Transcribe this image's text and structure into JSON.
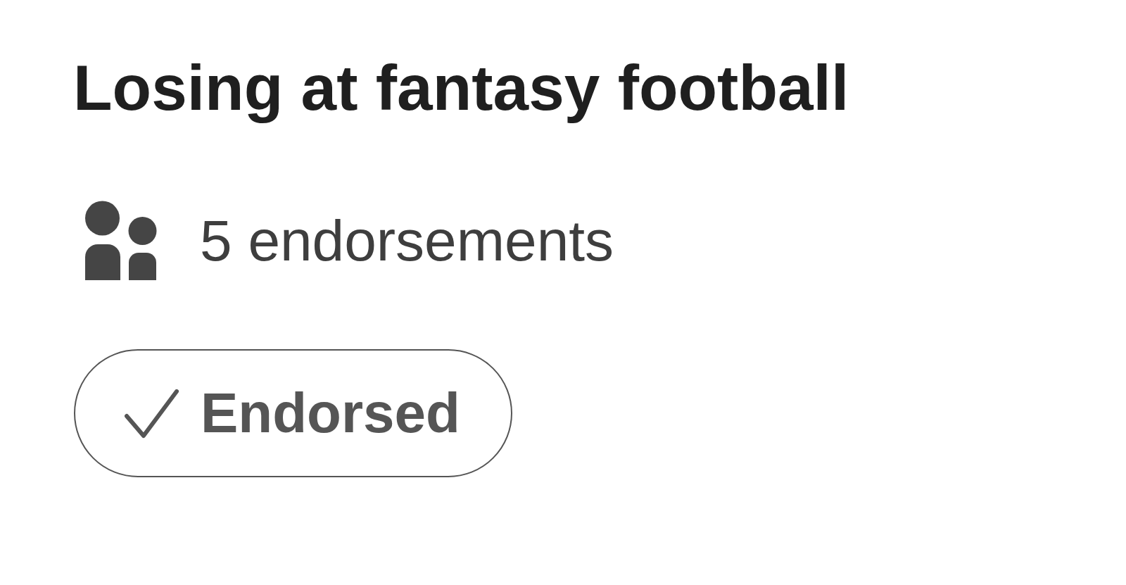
{
  "skill": {
    "title": "Losing at fantasy football",
    "endorsements": "5 endorsements",
    "endorse_button": {
      "label": "Endorsed",
      "endorsed": true
    }
  }
}
